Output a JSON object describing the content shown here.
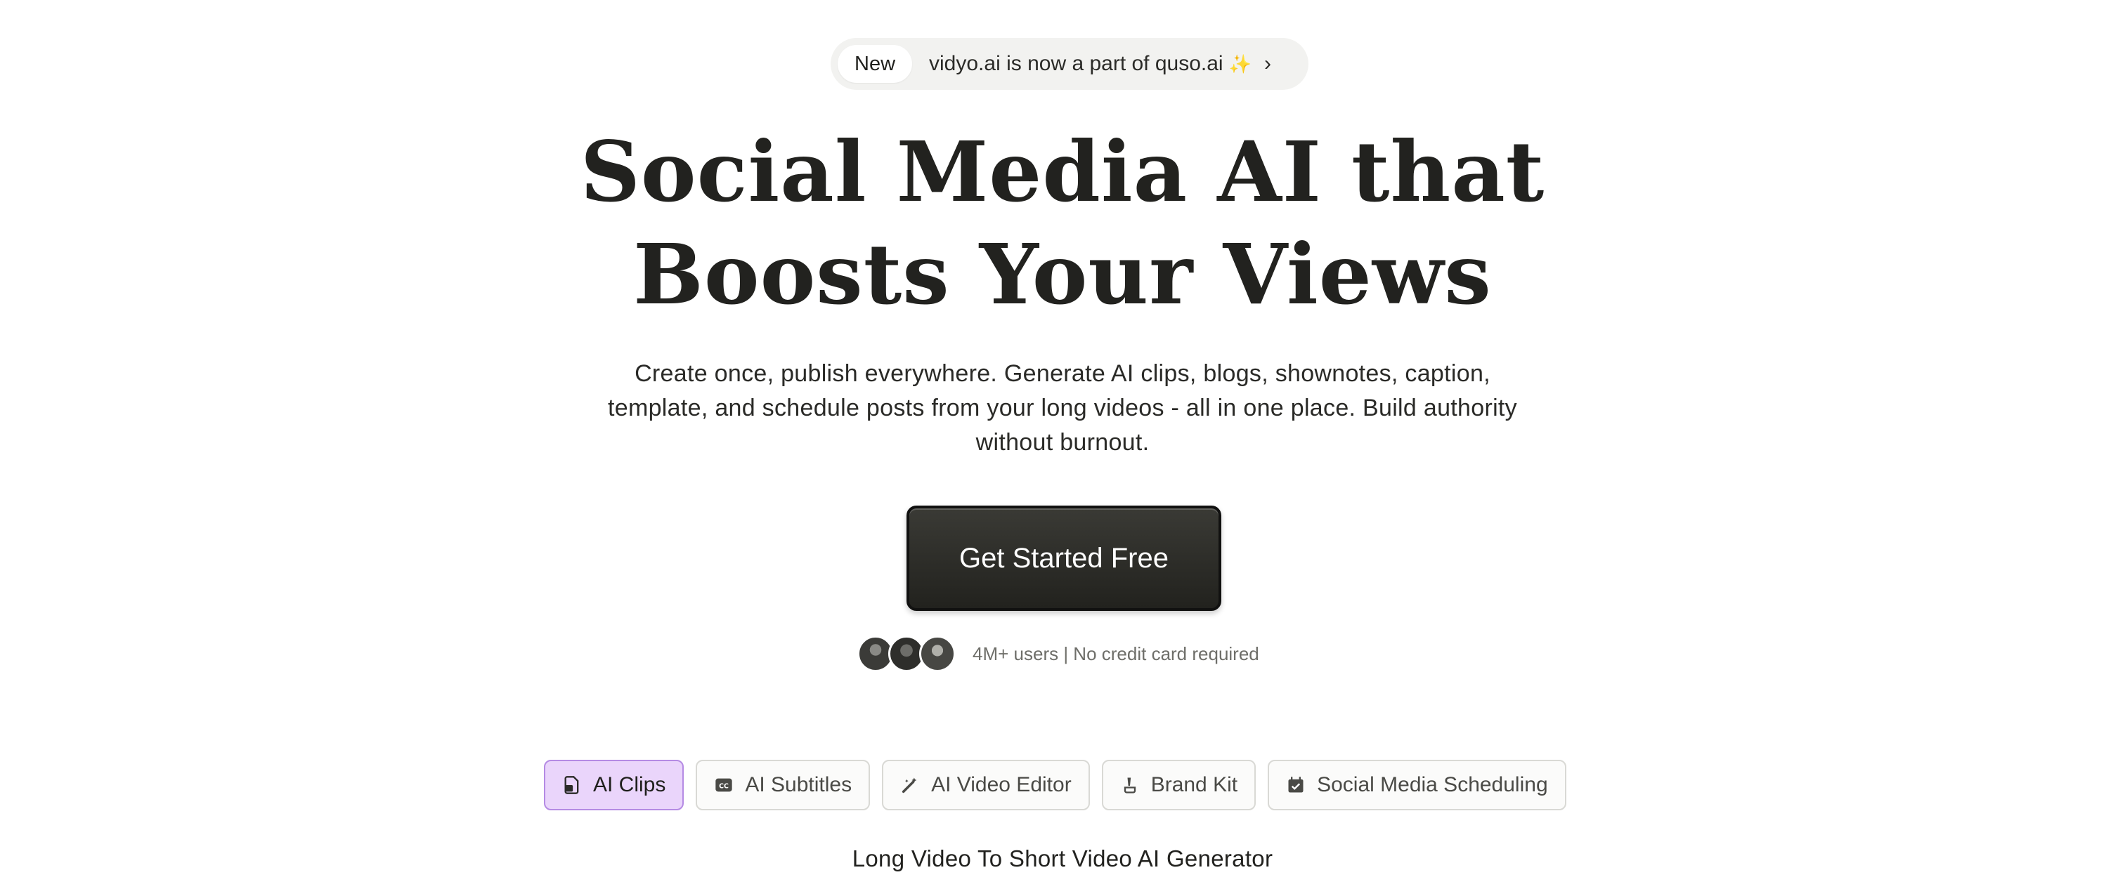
{
  "announcement": {
    "badge": "New",
    "message": "vidyo.ai is now a part of quso.ai",
    "sparkle": "✨",
    "chevron": "›"
  },
  "hero": {
    "title_line1": "Social Media AI that",
    "title_line2": "Boosts Your Views",
    "subtitle": "Create once, publish everywhere. Generate AI clips, blogs, shownotes, caption, template, and schedule posts from your long videos - all in one place. Build authority without burnout.",
    "cta_label": "Get Started Free"
  },
  "social_proof": {
    "text": "4M+ users | No credit card required"
  },
  "tabs": [
    {
      "label": "AI Clips",
      "icon": "clip-file-icon",
      "active": true
    },
    {
      "label": "AI Subtitles",
      "icon": "closed-captions-icon",
      "active": false
    },
    {
      "label": "AI Video Editor",
      "icon": "magic-wand-icon",
      "active": false
    },
    {
      "label": "Brand Kit",
      "icon": "brush-icon",
      "active": false
    },
    {
      "label": "Social Media Scheduling",
      "icon": "calendar-check-icon",
      "active": false
    }
  ],
  "section": {
    "caption": "Long Video To Short Video AI Generator"
  },
  "colors": {
    "active_tab_bg": "#ead5fb",
    "active_tab_border": "#b58be4",
    "cta_bg": "#22221e"
  }
}
